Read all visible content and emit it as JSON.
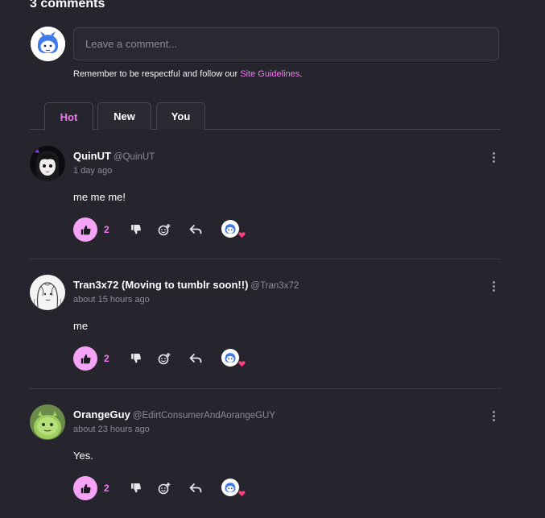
{
  "header": {
    "comment_count": "3 comments"
  },
  "composer": {
    "placeholder": "Leave a comment...",
    "guidelines_prefix": "Remember to be respectful and follow our ",
    "guidelines_link": "Site Guidelines",
    "guidelines_suffix": "."
  },
  "tabs": [
    {
      "label": "Hot",
      "active": true
    },
    {
      "label": "New",
      "active": false
    },
    {
      "label": "You",
      "active": false
    }
  ],
  "comments": [
    {
      "author": "QuinUT",
      "handle": "@QuinUT",
      "time": "1 day ago",
      "text": "me me me!",
      "likes": "2"
    },
    {
      "author": "Tran3x72 (Moving to tumblr soon!!)",
      "handle": "@Tran3x72",
      "time": "about 15 hours ago",
      "text": "me",
      "likes": "2"
    },
    {
      "author": "OrangeGuy",
      "handle": "@EdirtConsumerAndAorangeGUY",
      "time": "about 23 hours ago",
      "text": "Yes.",
      "likes": "2"
    }
  ],
  "colors": {
    "background": "#26242d",
    "accent": "#f07af2",
    "like_bg": "#f5a3f7",
    "heart": "#ff3d7f"
  },
  "icons": [
    "thumbs-up-icon",
    "thumbs-down-icon",
    "add-reaction-icon",
    "reply-icon",
    "heart-icon",
    "kebab-menu-icon"
  ]
}
